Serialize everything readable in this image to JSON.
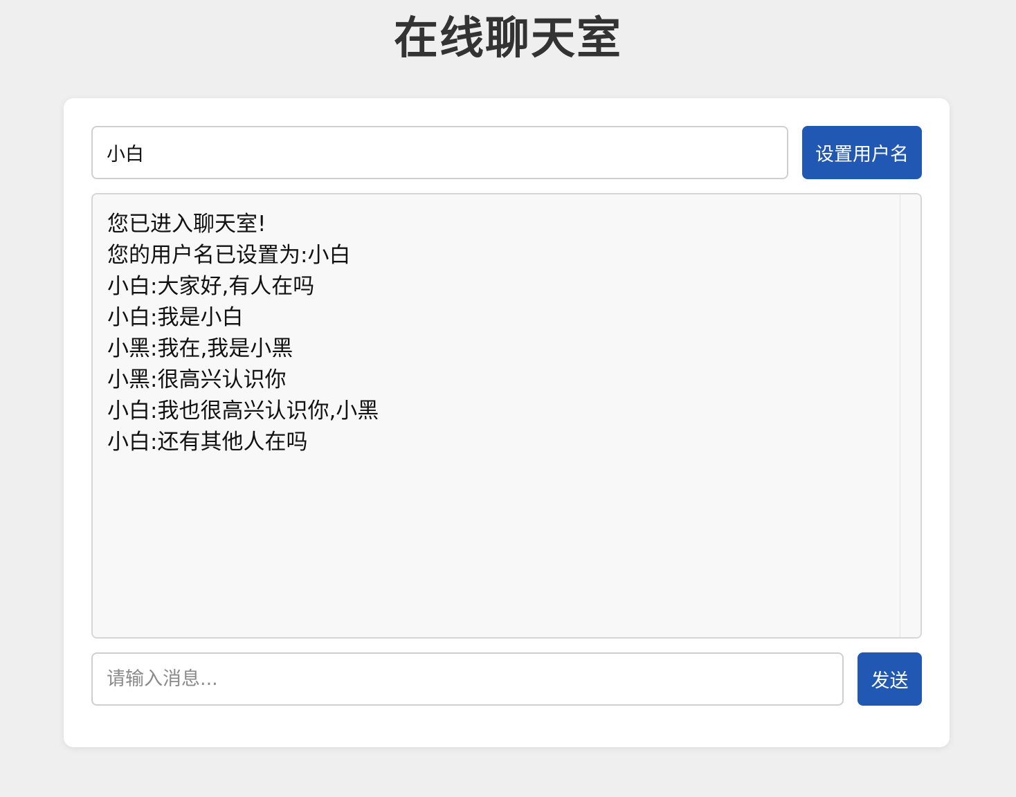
{
  "page": {
    "title": "在线聊天室"
  },
  "username": {
    "value": "小白",
    "button_label": "设置用户名"
  },
  "chat": {
    "messages": [
      "您已进入聊天室!",
      "您的用户名已设置为:小白",
      "小白:大家好,有人在吗",
      "小白:我是小白",
      "小黑:我在,我是小黑",
      "小黑:很高兴认识你",
      "小白:我也很高兴认识你,小黑",
      "小白:还有其他人在吗"
    ]
  },
  "message": {
    "placeholder": "请输入消息...",
    "value": "",
    "send_label": "发送"
  },
  "colors": {
    "accent": "#2158b3",
    "background": "#efefef",
    "card": "#ffffff"
  }
}
